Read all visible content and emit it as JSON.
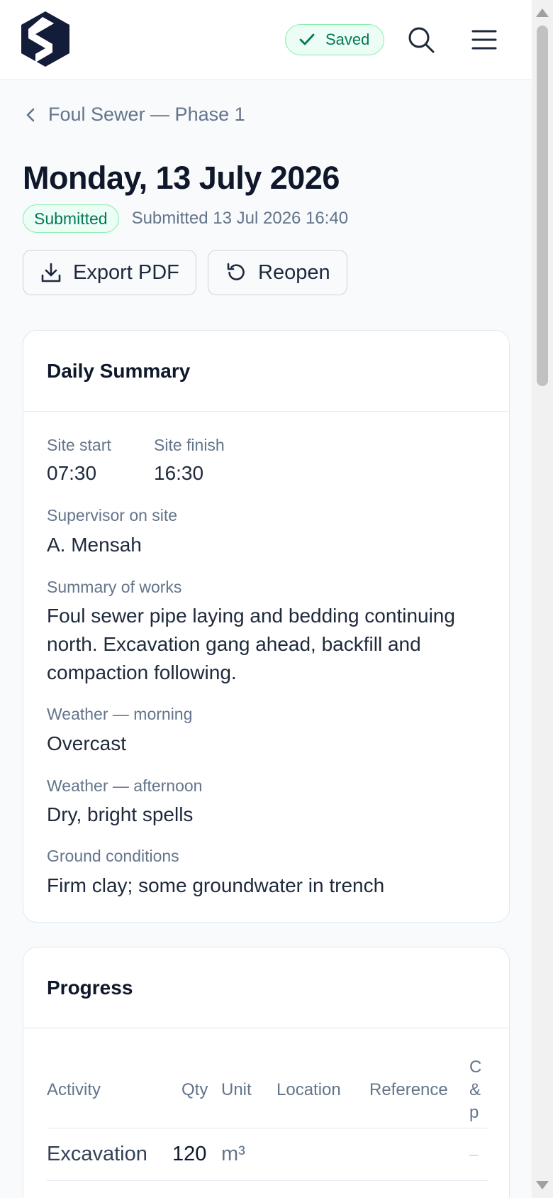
{
  "header": {
    "saved_label": "Saved",
    "search_icon": "search-icon",
    "menu_icon": "menu-icon",
    "colors": {
      "brand": "#131c38",
      "success": "#047857"
    }
  },
  "breadcrumb": {
    "label": "Foul Sewer — Phase 1"
  },
  "page": {
    "title": "Monday, 13 July 2026",
    "status": "Submitted",
    "submitted_meta": "Submitted 13 Jul 2026 16:40"
  },
  "actions": {
    "export_label": "Export PDF",
    "reopen_label": "Reopen"
  },
  "daily_summary": {
    "title": "Daily Summary",
    "site_start_label": "Site start",
    "site_start": "07:30",
    "site_finish_label": "Site finish",
    "site_finish": "16:30",
    "supervisor_label": "Supervisor on site",
    "supervisor": "A. Mensah",
    "works_label": "Summary of works",
    "works_line1": "Foul sewer pipe laying and bedding continuing",
    "works_line2": "north. Excavation gang ahead, backfill and",
    "works_line3": "compaction following.",
    "weather_am_label": "Weather — morning",
    "weather_am": "Overcast",
    "weather_pm_label": "Weather — afternoon",
    "weather_pm": "Dry, bright spells",
    "ground_label": "Ground conditions",
    "ground": "Firm clay; some groundwater in trench"
  },
  "progress": {
    "title": "Progress",
    "columns": {
      "activity": "Activity",
      "qty": "Qty",
      "unit": "Unit",
      "location": "Location",
      "reference": "Reference",
      "clipped_line1": "C",
      "clipped_line2": "&",
      "clipped_line3": "p"
    },
    "rows": [
      {
        "activity": "Excavation",
        "qty": "120",
        "unit": "m³",
        "last": "–"
      }
    ]
  }
}
